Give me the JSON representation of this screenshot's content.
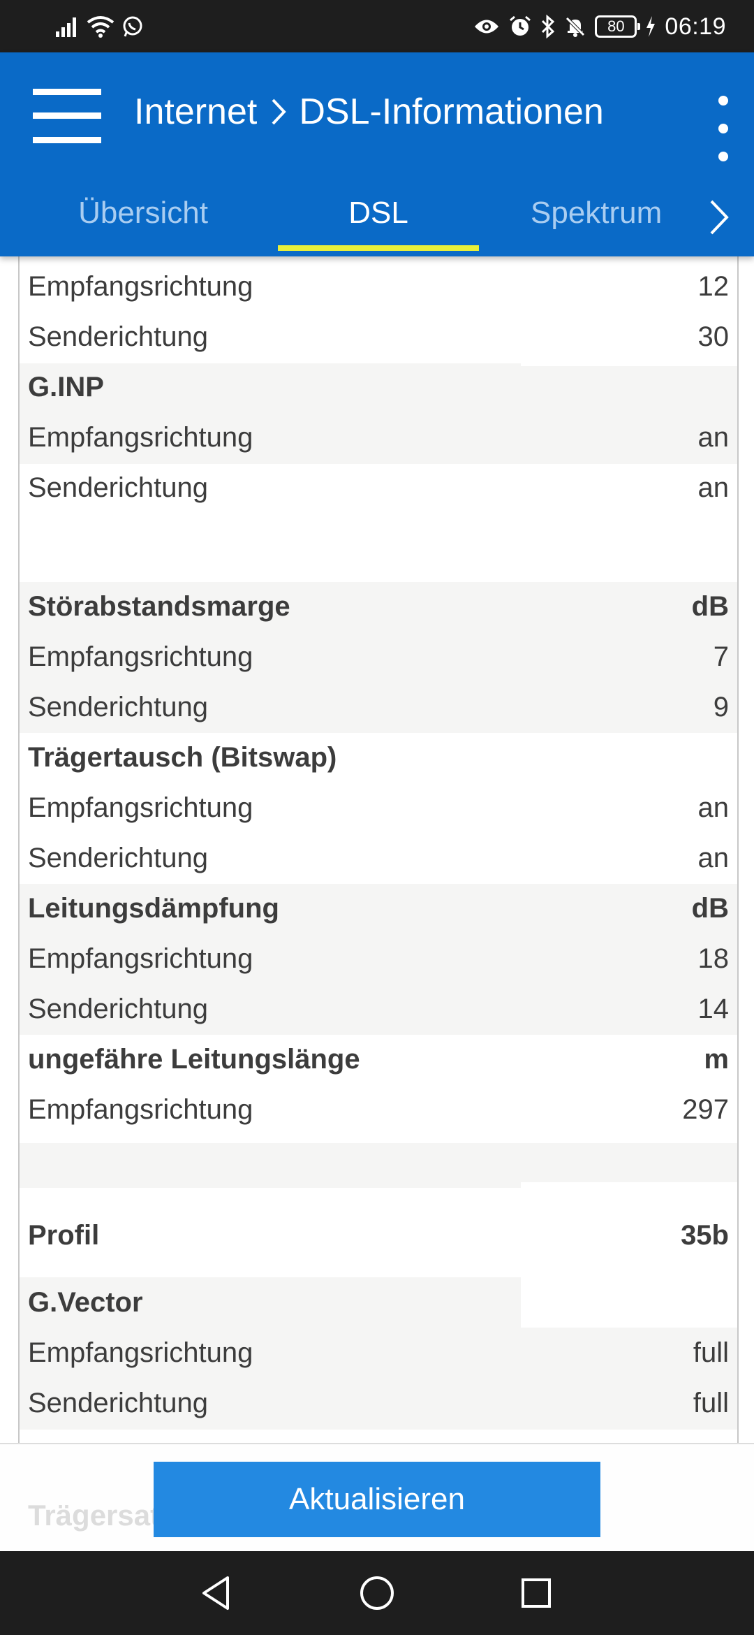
{
  "status_bar": {
    "time": "06:19",
    "battery": "80",
    "icons_left": [
      "signal-icon",
      "wifi-icon",
      "whatsapp-icon"
    ],
    "icons_right": [
      "eye-icon",
      "alarm-icon",
      "bluetooth-icon",
      "mute-icon",
      "battery-icon",
      "charging-icon"
    ]
  },
  "app_bar": {
    "breadcrumb": [
      "Internet",
      "DSL-Informationen"
    ],
    "color": "#0a6ac7"
  },
  "tabs": [
    {
      "label": "Übersicht",
      "active": false
    },
    {
      "label": "DSL",
      "active": true
    },
    {
      "label": "Spektrum",
      "active": false
    }
  ],
  "rows": [
    {
      "label": "Empfangsrichtung",
      "value": "12"
    },
    {
      "label": "Senderichtung",
      "value": "30"
    },
    {
      "label": "G.INP",
      "value": ""
    },
    {
      "label": "Empfangsrichtung",
      "value": "an"
    },
    {
      "label": "Senderichtung",
      "value": "an"
    },
    {
      "label": "Störabstandsmarge",
      "value": "dB"
    },
    {
      "label": "Empfangsrichtung",
      "value": "7"
    },
    {
      "label": "Senderichtung",
      "value": "9"
    },
    {
      "label": "Trägertausch (Bitswap)",
      "value": ""
    },
    {
      "label": "Empfangsrichtung",
      "value": "an"
    },
    {
      "label": "Senderichtung",
      "value": "an"
    },
    {
      "label": "Leitungsdämpfung",
      "value": "dB"
    },
    {
      "label": "Empfangsrichtung",
      "value": "18"
    },
    {
      "label": "Senderichtung",
      "value": "14"
    },
    {
      "label": "ungefähre Leitungslänge",
      "value": "m"
    },
    {
      "label": "Empfangsrichtung",
      "value": "297"
    },
    {
      "label": "Profil",
      "value": "35b"
    },
    {
      "label": "G.Vector",
      "value": ""
    },
    {
      "label": "Empfangsrichtung",
      "value": "full"
    },
    {
      "label": "Senderichtung",
      "value": "full"
    }
  ],
  "bottom": {
    "update_button": "Aktualisieren",
    "partial_heading": "Trägersatz"
  }
}
